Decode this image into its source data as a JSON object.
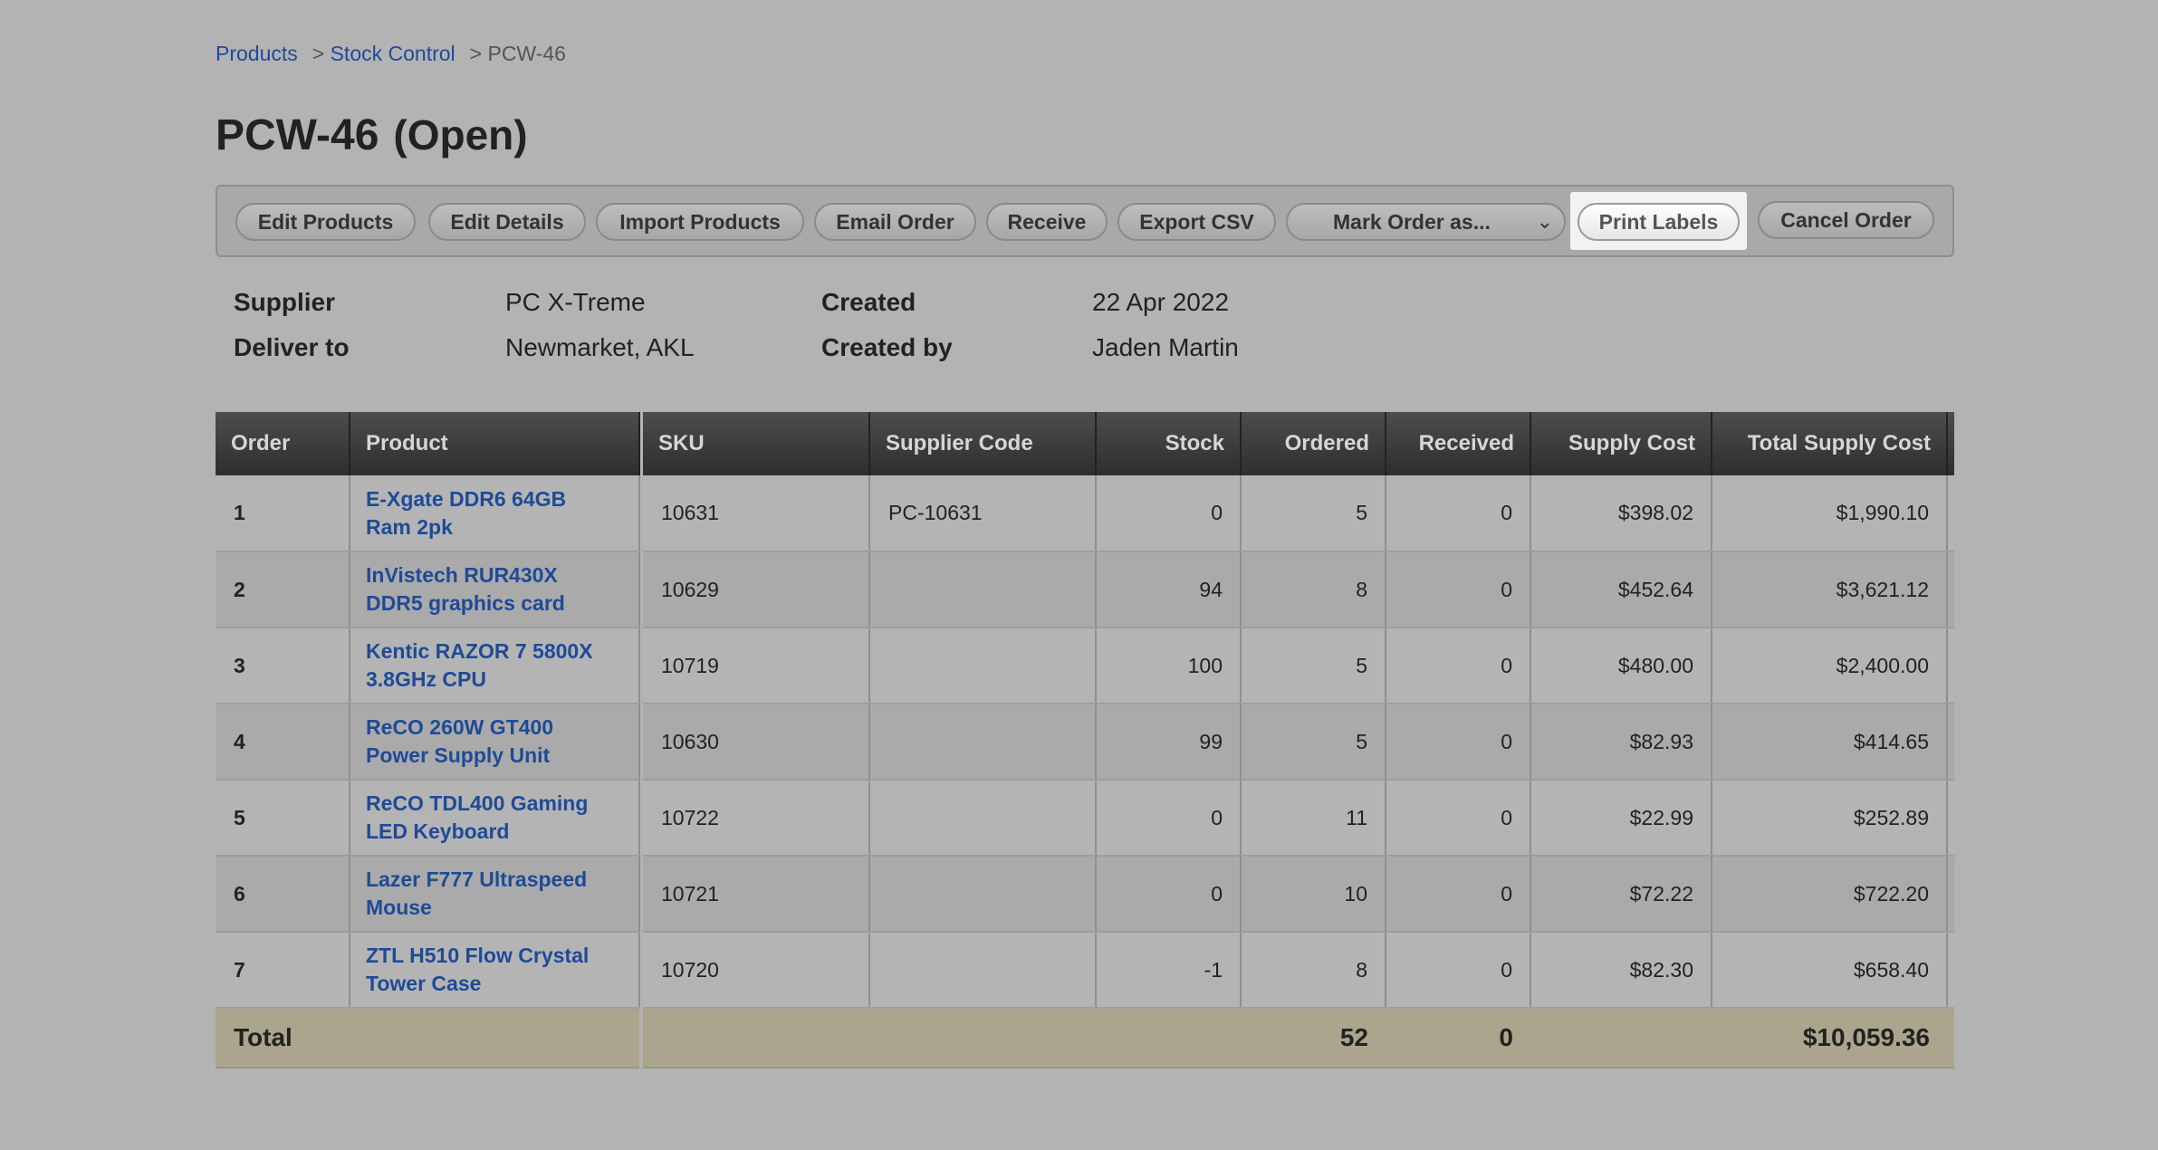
{
  "breadcrumb": {
    "items": [
      "Products",
      "Stock Control"
    ],
    "separator": ">",
    "current": "PCW-46"
  },
  "title": {
    "code": "PCW-46",
    "status": "(Open)"
  },
  "toolbar": {
    "edit_products": "Edit Products",
    "edit_details": "Edit Details",
    "import_products": "Import Products",
    "email_order": "Email Order",
    "receive": "Receive",
    "export_csv": "Export CSV",
    "mark_order_as": "Mark Order as...",
    "print_labels": "Print Labels",
    "cancel_order": "Cancel Order"
  },
  "details": {
    "supplier_label": "Supplier",
    "supplier": "PC X-Treme",
    "deliver_label": "Deliver to",
    "deliver": "Newmarket, AKL",
    "created_label": "Created",
    "created": "22 Apr 2022",
    "created_by_label": "Created by",
    "created_by": "Jaden Martin"
  },
  "table": {
    "headers": {
      "order": "Order",
      "product": "Product",
      "sku": "SKU",
      "supplier_code": "Supplier Code",
      "stock": "Stock",
      "ordered": "Ordered",
      "received": "Received",
      "supply_cost": "Supply Cost",
      "total_supply_cost": "Total Supply Cost"
    },
    "rows": [
      {
        "order": "1",
        "product_l1": "E-Xgate DDR6 64GB",
        "product_l2": "Ram 2pk",
        "sku": "10631",
        "supplier_code": "PC-10631",
        "stock": "0",
        "ordered": "5",
        "received": "0",
        "supply_cost": "$398.02",
        "total": "$1,990.10"
      },
      {
        "order": "2",
        "product_l1": "InVistech RUR430X",
        "product_l2": "DDR5 graphics card",
        "sku": "10629",
        "supplier_code": "",
        "stock": "94",
        "ordered": "8",
        "received": "0",
        "supply_cost": "$452.64",
        "total": "$3,621.12"
      },
      {
        "order": "3",
        "product_l1": "Kentic RAZOR 7 5800X",
        "product_l2": "3.8GHz CPU",
        "sku": "10719",
        "supplier_code": "",
        "stock": "100",
        "ordered": "5",
        "received": "0",
        "supply_cost": "$480.00",
        "total": "$2,400.00"
      },
      {
        "order": "4",
        "product_l1": "ReCO 260W GT400",
        "product_l2": "Power Supply Unit",
        "sku": "10630",
        "supplier_code": "",
        "stock": "99",
        "ordered": "5",
        "received": "0",
        "supply_cost": "$82.93",
        "total": "$414.65"
      },
      {
        "order": "5",
        "product_l1": "ReCO TDL400 Gaming",
        "product_l2": "LED Keyboard",
        "sku": "10722",
        "supplier_code": "",
        "stock": "0",
        "ordered": "11",
        "received": "0",
        "supply_cost": "$22.99",
        "total": "$252.89"
      },
      {
        "order": "6",
        "product_l1": "Lazer F777 Ultraspeed",
        "product_l2": "Mouse",
        "sku": "10721",
        "supplier_code": "",
        "stock": "0",
        "ordered": "10",
        "received": "0",
        "supply_cost": "$72.22",
        "total": "$722.20"
      },
      {
        "order": "7",
        "product_l1": "ZTL H510 Flow Crystal",
        "product_l2": "Tower Case",
        "sku": "10720",
        "supplier_code": "",
        "stock": "-1",
        "ordered": "8",
        "received": "0",
        "supply_cost": "$82.30",
        "total": "$658.40"
      }
    ],
    "total": {
      "label": "Total",
      "ordered": "52",
      "received": "0",
      "total_supply_cost": "$10,059.36"
    }
  },
  "colors": {
    "link": "#1f4a96",
    "header_bg": "#3a3a3a",
    "total_bg": "#aba58d",
    "page_bg": "#b3b3b3"
  }
}
